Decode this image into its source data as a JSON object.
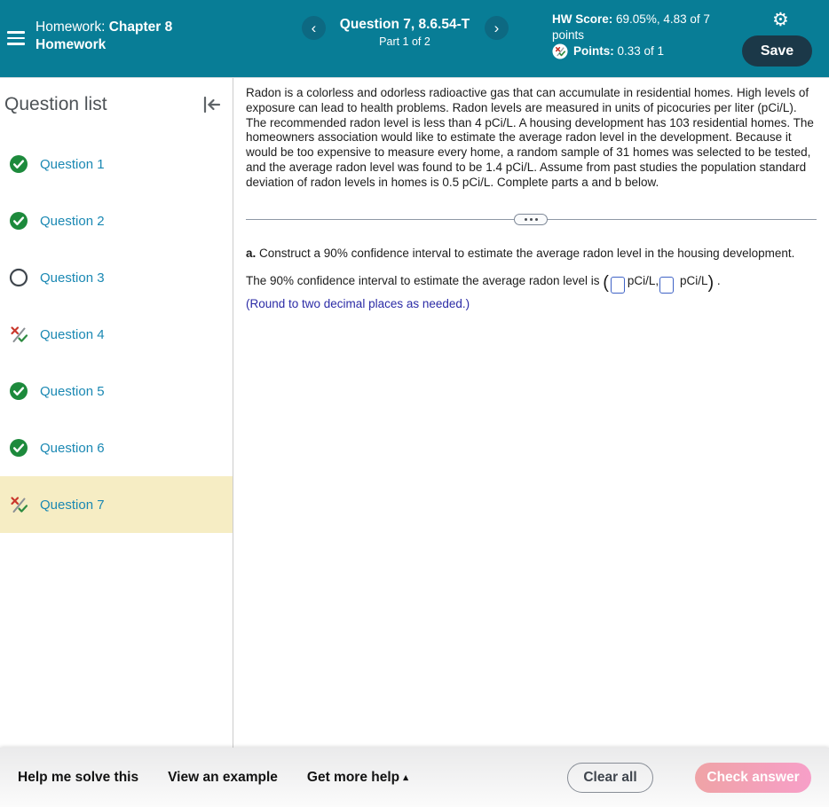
{
  "colors": {
    "header_teal": "#087d96",
    "nav_circle": "#0d6982",
    "save_navy": "#1b3848",
    "active_highlight": "#f6edc4",
    "question_link": "#1a88b3",
    "correct_green": "#1d8a3c",
    "incorrect_red": "#c9372c",
    "note_blue": "#2b2ba6",
    "input_border_blue": "#3f63c6",
    "check_pink_start": "#efa3a6",
    "check_pink_end": "#f79fc8"
  },
  "icons": {
    "prev": "‹",
    "next": "›",
    "settings": "⚙",
    "caret_up": "▴"
  },
  "header": {
    "course_label": "Homework:",
    "assignment_name": "Chapter 8 Homework",
    "question_title": "Question 7, 8.6.54-T",
    "question_part": "Part 1 of 2",
    "hw_score_label": "HW Score:",
    "hw_score_value": "69.05%, 4.83 of 7 points",
    "points_label": "Points:",
    "points_value": "0.33 of 1",
    "save_label": "Save"
  },
  "sidebar": {
    "title": "Question list",
    "items": [
      {
        "label": "Question 1",
        "status": "correct",
        "active": false
      },
      {
        "label": "Question 2",
        "status": "correct",
        "active": false
      },
      {
        "label": "Question 3",
        "status": "unanswered",
        "active": false
      },
      {
        "label": "Question 4",
        "status": "partial",
        "active": false
      },
      {
        "label": "Question 5",
        "status": "correct",
        "active": false
      },
      {
        "label": "Question 6",
        "status": "correct",
        "active": false
      },
      {
        "label": "Question 7",
        "status": "partial",
        "active": true
      }
    ]
  },
  "main": {
    "problem_text": "Radon is a colorless and odorless radioactive gas that can accumulate in residential homes. High levels of exposure can lead to health problems. Radon levels are measured in units of picocuries per liter (pCi/L). The recommended radon level is less than 4 pCi/L. A housing development has 103 residential homes. The homeowners association would like to estimate the average radon level in the development. Because it would be too expensive to measure every home, a random sample of 31 homes was selected to be tested, and the average radon level was found to be 1.4 pCi/L. Assume from past studies the population standard deviation of radon levels in homes is 0.5 pCi/L. Complete parts a and b below.",
    "part_a": {
      "prefix": "a.",
      "prompt": " Construct a 90% confidence interval to estimate the average radon level in the housing development.",
      "answer_sentence": "The 90% confidence interval to estimate the average radon level is ",
      "paren_open": "(",
      "unit_after_first": "pCi/L,",
      "unit_after_second": "pCi/L",
      "paren_close": ")",
      "terminal_punctuation": ".",
      "input1_value": "",
      "input2_value": "",
      "round_note": "(Round to two decimal places as needed.)"
    }
  },
  "footer": {
    "help_me_label": "Help me solve this",
    "view_example_label": "View an example",
    "get_more_help_label": "Get more help ",
    "clear_all_label": "Clear all",
    "check_answer_label": "Check answer"
  }
}
